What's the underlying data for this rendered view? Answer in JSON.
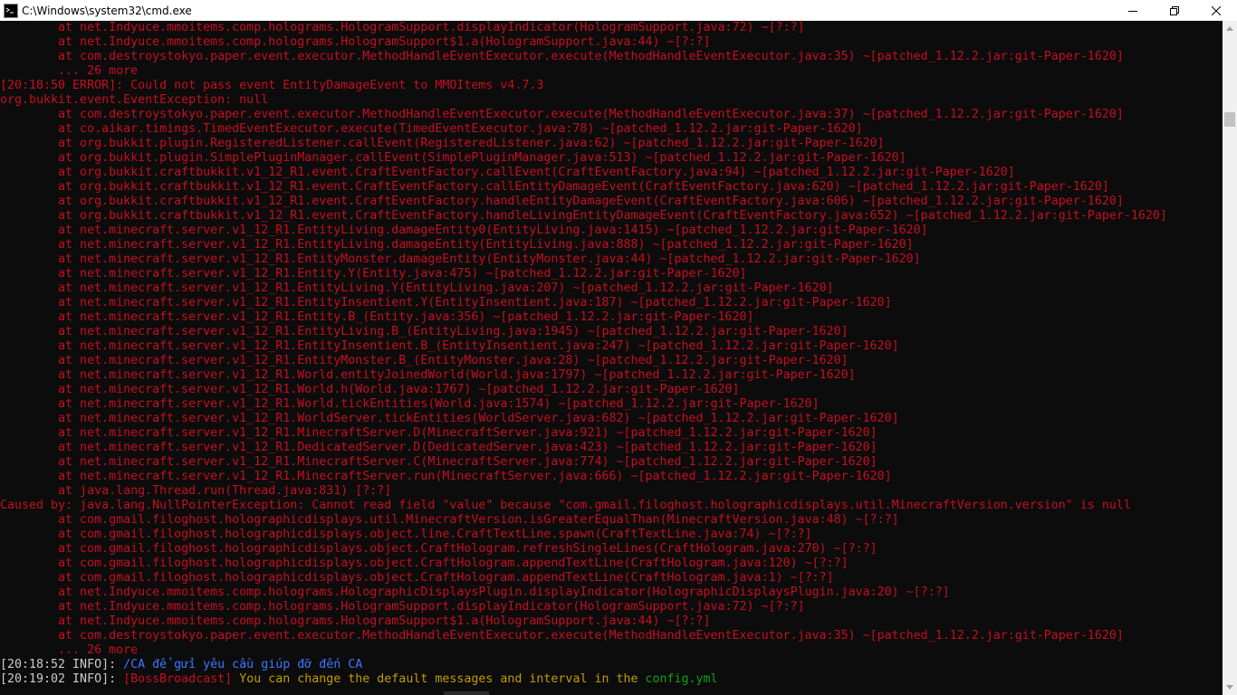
{
  "window": {
    "title": "C:\\Windows\\system32\\cmd.exe",
    "icon": "cmd-icon",
    "controls": [
      "minimize-icon",
      "restore-icon",
      "close-icon"
    ]
  },
  "colors": {
    "background": "#0c0c0c",
    "error_red": "#c50f1f",
    "info_white": "#cccccc",
    "link_blue": "#3b78ff",
    "gold": "#c19c00",
    "green": "#13a10e"
  },
  "console": {
    "lines": [
      "        at net.Indyuce.mmoitems.comp.holograms.HologramSupport.displayIndicator(HologramSupport.java:72) ~[?:?]",
      "        at net.Indyuce.mmoitems.comp.holograms.HologramSupport$1.a(HologramSupport.java:44) ~[?:?]",
      "        at com.destroystokyo.paper.event.executor.MethodHandleEventExecutor.execute(MethodHandleEventExecutor.java:35) ~[patched_1.12.2.jar:git-Paper-1620]",
      "        ... 26 more",
      "[20:18:50 ERROR]: Could not pass event EntityDamageEvent to MMOItems v4.7.3",
      "org.bukkit.event.EventException: null",
      "        at com.destroystokyo.paper.event.executor.MethodHandleEventExecutor.execute(MethodHandleEventExecutor.java:37) ~[patched_1.12.2.jar:git-Paper-1620]",
      "        at co.aikar.timings.TimedEventExecutor.execute(TimedEventExecutor.java:78) ~[patched_1.12.2.jar:git-Paper-1620]",
      "        at org.bukkit.plugin.RegisteredListener.callEvent(RegisteredListener.java:62) ~[patched_1.12.2.jar:git-Paper-1620]",
      "        at org.bukkit.plugin.SimplePluginManager.callEvent(SimplePluginManager.java:513) ~[patched_1.12.2.jar:git-Paper-1620]",
      "        at org.bukkit.craftbukkit.v1_12_R1.event.CraftEventFactory.callEvent(CraftEventFactory.java:94) ~[patched_1.12.2.jar:git-Paper-1620]",
      "        at org.bukkit.craftbukkit.v1_12_R1.event.CraftEventFactory.callEntityDamageEvent(CraftEventFactory.java:620) ~[patched_1.12.2.jar:git-Paper-1620]",
      "        at org.bukkit.craftbukkit.v1_12_R1.event.CraftEventFactory.handleEntityDamageEvent(CraftEventFactory.java:606) ~[patched_1.12.2.jar:git-Paper-1620]",
      "        at org.bukkit.craftbukkit.v1_12_R1.event.CraftEventFactory.handleLivingEntityDamageEvent(CraftEventFactory.java:652) ~[patched_1.12.2.jar:git-Paper-1620]",
      "        at net.minecraft.server.v1_12_R1.EntityLiving.damageEntity0(EntityLiving.java:1415) ~[patched_1.12.2.jar:git-Paper-1620]",
      "        at net.minecraft.server.v1_12_R1.EntityLiving.damageEntity(EntityLiving.java:888) ~[patched_1.12.2.jar:git-Paper-1620]",
      "        at net.minecraft.server.v1_12_R1.EntityMonster.damageEntity(EntityMonster.java:44) ~[patched_1.12.2.jar:git-Paper-1620]",
      "        at net.minecraft.server.v1_12_R1.Entity.Y(Entity.java:475) ~[patched_1.12.2.jar:git-Paper-1620]",
      "        at net.minecraft.server.v1_12_R1.EntityLiving.Y(EntityLiving.java:207) ~[patched_1.12.2.jar:git-Paper-1620]",
      "        at net.minecraft.server.v1_12_R1.EntityInsentient.Y(EntityInsentient.java:187) ~[patched_1.12.2.jar:git-Paper-1620]",
      "        at net.minecraft.server.v1_12_R1.Entity.B_(Entity.java:356) ~[patched_1.12.2.jar:git-Paper-1620]",
      "        at net.minecraft.server.v1_12_R1.EntityLiving.B_(EntityLiving.java:1945) ~[patched_1.12.2.jar:git-Paper-1620]",
      "        at net.minecraft.server.v1_12_R1.EntityInsentient.B_(EntityInsentient.java:247) ~[patched_1.12.2.jar:git-Paper-1620]",
      "        at net.minecraft.server.v1_12_R1.EntityMonster.B_(EntityMonster.java:28) ~[patched_1.12.2.jar:git-Paper-1620]",
      "        at net.minecraft.server.v1_12_R1.World.entityJoinedWorld(World.java:1797) ~[patched_1.12.2.jar:git-Paper-1620]",
      "        at net.minecraft.server.v1_12_R1.World.h(World.java:1767) ~[patched_1.12.2.jar:git-Paper-1620]",
      "        at net.minecraft.server.v1_12_R1.World.tickEntities(World.java:1574) ~[patched_1.12.2.jar:git-Paper-1620]",
      "        at net.minecraft.server.v1_12_R1.WorldServer.tickEntities(WorldServer.java:682) ~[patched_1.12.2.jar:git-Paper-1620]",
      "        at net.minecraft.server.v1_12_R1.MinecraftServer.D(MinecraftServer.java:921) ~[patched_1.12.2.jar:git-Paper-1620]",
      "        at net.minecraft.server.v1_12_R1.DedicatedServer.D(DedicatedServer.java:423) ~[patched_1.12.2.jar:git-Paper-1620]",
      "        at net.minecraft.server.v1_12_R1.MinecraftServer.C(MinecraftServer.java:774) ~[patched_1.12.2.jar:git-Paper-1620]",
      "        at net.minecraft.server.v1_12_R1.MinecraftServer.run(MinecraftServer.java:666) ~[patched_1.12.2.jar:git-Paper-1620]",
      "        at java.lang.Thread.run(Thread.java:831) [?:?]",
      "Caused by: java.lang.NullPointerException: Cannot read field \"value\" because \"com.gmail.filoghost.holographicdisplays.util.MinecraftVersion.version\" is null",
      "        at com.gmail.filoghost.holographicdisplays.util.MinecraftVersion.isGreaterEqualThan(MinecraftVersion.java:48) ~[?:?]",
      "        at com.gmail.filoghost.holographicdisplays.object.line.CraftTextLine.spawn(CraftTextLine.java:74) ~[?:?]",
      "        at com.gmail.filoghost.holographicdisplays.object.CraftHologram.refreshSingleLines(CraftHologram.java:270) ~[?:?]",
      "        at com.gmail.filoghost.holographicdisplays.object.CraftHologram.appendTextLine(CraftHologram.java:120) ~[?:?]",
      "        at com.gmail.filoghost.holographicdisplays.object.CraftHologram.appendTextLine(CraftHologram.java:1) ~[?:?]",
      "        at net.Indyuce.mmoitems.comp.holograms.HolographicDisplaysPlugin.displayIndicator(HolographicDisplaysPlugin.java:20) ~[?:?]",
      "        at net.Indyuce.mmoitems.comp.holograms.HologramSupport.displayIndicator(HologramSupport.java:72) ~[?:?]",
      "        at net.Indyuce.mmoitems.comp.holograms.HologramSupport$1.a(HologramSupport.java:44) ~[?:?]",
      "        at com.destroystokyo.paper.event.executor.MethodHandleEventExecutor.execute(MethodHandleEventExecutor.java:35) ~[patched_1.12.2.jar:git-Paper-1620]",
      "        ... 26 more"
    ],
    "info_line_1": {
      "prefix": "[20:18:52 INFO]: ",
      "message": "/CA để gửi yêu cầu giúp đỡ đến CA"
    },
    "info_line_2": {
      "prefix": "[20:19:02 INFO]: ",
      "tag": "[BossBroadcast]",
      "message": " You can change the default messages and interval in the ",
      "file": "config.yml"
    }
  }
}
